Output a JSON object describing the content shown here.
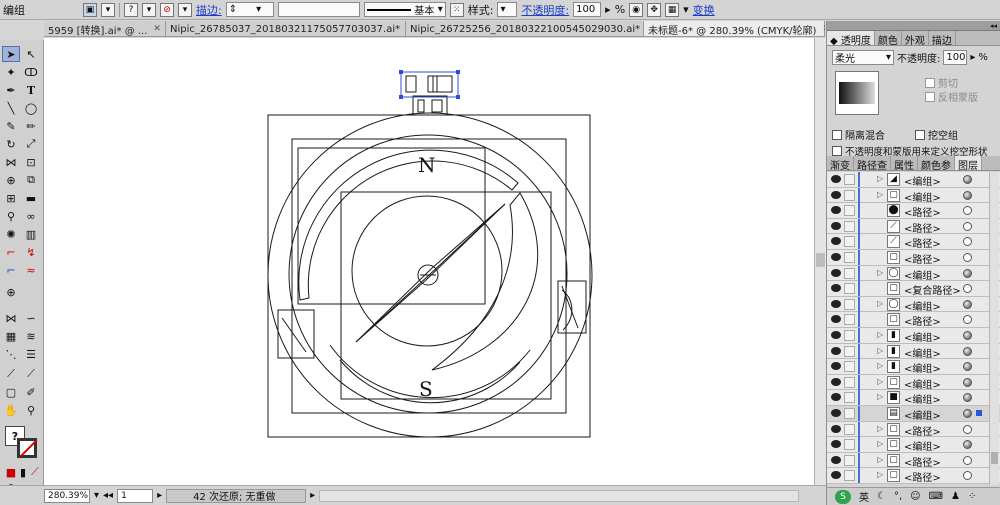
{
  "control_bar": {
    "object_type": "编组",
    "stroke_label": "描边:",
    "profile_label": "基本",
    "style_label": "样式:",
    "opacity_label": "不透明度:",
    "opacity_value": "100",
    "opacity_unit": "%",
    "transform_label": "变换"
  },
  "tabs": [
    {
      "label": "5959 [转换].ai* @ ...",
      "active": false
    },
    {
      "label": "Nipic_26785037_20180321175057703037.ai*",
      "active": false
    },
    {
      "label": "Nipic_26725256_20180322100545029030.ai*",
      "active": false
    },
    {
      "label": "未标题-6* @ 280.39% (CMYK/轮廓)",
      "active": true
    }
  ],
  "canvas_art": {
    "north_label": "N",
    "south_label": "S"
  },
  "status_bar": {
    "zoom": "280.39%",
    "page": "1",
    "message": "42 次还原; 无重做"
  },
  "transparency_panel": {
    "tabs": [
      "透明度",
      "颜色",
      "外观",
      "描边"
    ],
    "blend_mode": "柔光",
    "opacity_label": "不透明度:",
    "opacity_value": "100",
    "opacity_unit": "%",
    "clip_label": "剪切",
    "invert_mask_label": "反相蒙版",
    "isolate_blending_label": "隔离混合",
    "knockout_group_label": "挖空组",
    "opacity_mask_label": "不透明度和蒙版用来定义挖空形状"
  },
  "layers_panel": {
    "tabs": [
      "渐变",
      "路径查",
      "属性",
      "颜色参",
      "图层"
    ],
    "rows": [
      {
        "name": "<编组>",
        "arrow": true,
        "target_filled": true
      },
      {
        "name": "<编组>",
        "arrow": true,
        "target_filled": true
      },
      {
        "name": "<路径>",
        "arrow": false,
        "target_filled": false
      },
      {
        "name": "<路径>",
        "arrow": false,
        "target_filled": false
      },
      {
        "name": "<路径>",
        "arrow": false,
        "target_filled": false
      },
      {
        "name": "<路径>",
        "arrow": false,
        "target_filled": false
      },
      {
        "name": "<编组>",
        "arrow": true,
        "target_filled": true
      },
      {
        "name": "<复合路径>",
        "arrow": false,
        "target_filled": false
      },
      {
        "name": "<编组>",
        "arrow": true,
        "target_filled": true
      },
      {
        "name": "<路径>",
        "arrow": false,
        "target_filled": false
      },
      {
        "name": "<编组>",
        "arrow": true,
        "target_filled": true
      },
      {
        "name": "<编组>",
        "arrow": true,
        "target_filled": true
      },
      {
        "name": "<编组>",
        "arrow": true,
        "target_filled": true
      },
      {
        "name": "<编组>",
        "arrow": true,
        "target_filled": true
      },
      {
        "name": "<编组>",
        "arrow": true,
        "target_filled": true
      },
      {
        "name": "<编组>",
        "arrow": false,
        "target_filled": true,
        "selected": true
      },
      {
        "name": "<路径>",
        "arrow": true,
        "target_filled": false
      },
      {
        "name": "<编组>",
        "arrow": true,
        "target_filled": true
      },
      {
        "name": "<路径>",
        "arrow": true,
        "target_filled": false
      },
      {
        "name": "<路径>",
        "arrow": true,
        "target_filled": false
      }
    ]
  },
  "ime_bar": {
    "label": "英"
  }
}
